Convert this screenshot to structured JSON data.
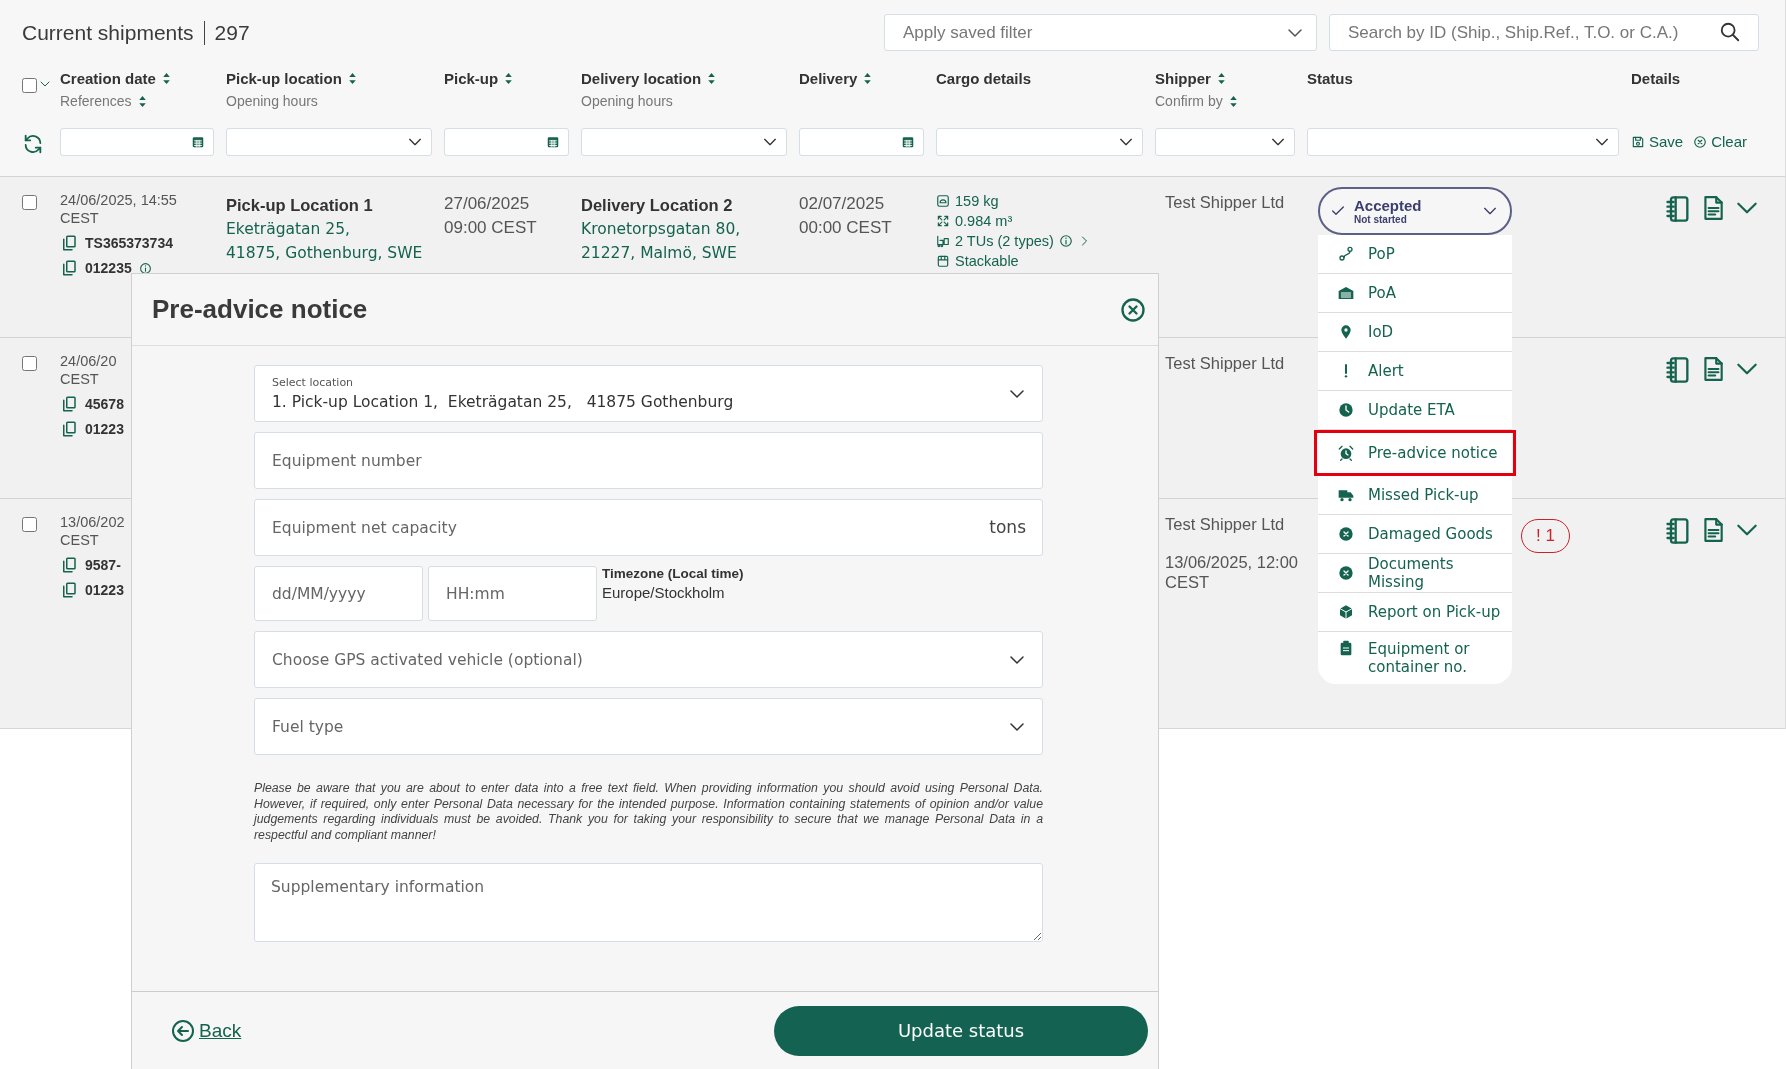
{
  "header": {
    "title": "Current shipments",
    "count": "297",
    "saved_filter": {
      "placeholder": "Apply saved filter"
    },
    "search": {
      "placeholder": "Search by ID (Ship., Ship.Ref., T.O. or C.A.)"
    }
  },
  "table": {
    "select_all": {
      "checked": false
    },
    "columns": [
      {
        "label": "Creation date",
        "sortable": true,
        "sub_label": "References",
        "sub_sortable": true,
        "filter": {
          "kind": "date"
        }
      },
      {
        "label": "Pick-up location",
        "sortable": true,
        "sub_label": "Opening hours",
        "sub_sortable": false,
        "filter": {
          "kind": "select"
        }
      },
      {
        "label": "Pick-up",
        "sortable": true,
        "filter": {
          "kind": "date"
        }
      },
      {
        "label": "Delivery location",
        "sortable": true,
        "sub_label": "Opening hours",
        "sub_sortable": false,
        "filter": {
          "kind": "select"
        }
      },
      {
        "label": "Delivery",
        "sortable": true,
        "filter": {
          "kind": "date"
        }
      },
      {
        "label": "Cargo details",
        "sortable": false,
        "filter": {
          "kind": "select"
        }
      },
      {
        "label": "Shipper",
        "sortable": true,
        "sub_label": "Confirm by",
        "sub_sortable": true,
        "filter": {
          "kind": "select"
        }
      },
      {
        "label": "Status",
        "sortable": false,
        "filter": {
          "kind": "select"
        }
      },
      {
        "label": "Details",
        "sortable": false,
        "filter": {
          "kind": "actions"
        }
      }
    ],
    "filter_actions": [
      {
        "kind": "save",
        "label": "Save"
      },
      {
        "kind": "clear",
        "label": "Clear"
      }
    ],
    "rows": [
      {
        "checked": false,
        "created": "24/06/2025, 14:55",
        "created_tz": "CEST",
        "references": [
          {
            "text": "TS365373734",
            "info": false
          },
          {
            "text": "012235",
            "info": true
          }
        ],
        "pickup_location": {
          "name": "Pick-up Location 1",
          "address": [
            "Eketrägatan 25,",
            "41875, Gothenburg, SWE"
          ]
        },
        "pickup": [
          "27/06/2025",
          "09:00 CEST"
        ],
        "delivery_location": {
          "name": "Delivery Location 2",
          "address": [
            "Kronetorpsgatan 80,",
            "21227, Malmö, SWE"
          ]
        },
        "delivery": [
          "02/07/2025",
          "00:00 CEST"
        ],
        "cargo": [
          {
            "kind": "weight",
            "text": "159 kg"
          },
          {
            "kind": "volume",
            "text": "0.984 m³"
          },
          {
            "kind": "units",
            "text": "2 TUs (2 types)",
            "info": true,
            "expandable": true
          },
          {
            "kind": "stackable",
            "text": "Stackable"
          }
        ],
        "shipper": "Test Shipper Ltd"
      },
      {
        "checked": false,
        "created": "24/06/20",
        "created_tz": "CEST",
        "references": [
          {
            "text": "45678"
          },
          {
            "text": "01223"
          }
        ],
        "shipper": "Test Shipper Ltd"
      },
      {
        "checked": false,
        "created": "13/06/202",
        "created_tz": "CEST",
        "references": [
          {
            "text": "9587-"
          },
          {
            "text": "01223"
          }
        ],
        "shipper": "Test Shipper Ltd",
        "confirm_by": "13/06/2025, 12:00 CEST",
        "alerts": "! 1"
      }
    ]
  },
  "status_menu": {
    "status": "Accepted",
    "substatus": "Not started",
    "items": [
      {
        "kind": "pop",
        "label": "PoP",
        "highlighted": false
      },
      {
        "kind": "poa",
        "label": "PoA",
        "highlighted": false
      },
      {
        "kind": "iod",
        "label": "IoD",
        "highlighted": false
      },
      {
        "kind": "alert",
        "label": "Alert",
        "highlighted": false
      },
      {
        "kind": "eta",
        "label": "Update ETA",
        "highlighted": false
      },
      {
        "kind": "pre_advice",
        "label": "Pre-advice notice",
        "highlighted": true
      },
      {
        "kind": "missed_pickup",
        "label": "Missed Pick-up",
        "highlighted": false
      },
      {
        "kind": "damaged",
        "label": "Damaged Goods",
        "highlighted": false
      },
      {
        "kind": "documents",
        "label": "Documents Missing",
        "highlighted": false
      },
      {
        "kind": "report",
        "label": "Report on Pick-up",
        "highlighted": false
      },
      {
        "kind": "equipment",
        "label": "Equipment or container no.",
        "highlighted": false
      }
    ]
  },
  "modal": {
    "title": "Pre-advice notice",
    "fields": [
      {
        "kind": "select",
        "label": "Select location",
        "value": "1. Pick-up Location 1,  Eketrägatan 25,   41875 Gothenburg"
      },
      {
        "kind": "text",
        "placeholder": "Equipment number"
      },
      {
        "kind": "unit",
        "placeholder": "Equipment net capacity",
        "unit": "tons"
      },
      {
        "kind": "datetime",
        "date_placeholder": "dd/MM/yyyy",
        "time_placeholder": "HH:mm",
        "timezone_label": "Timezone (Local time)",
        "timezone": "Europe/Stockholm"
      },
      {
        "kind": "select",
        "placeholder": "Choose GPS activated vehicle (optional)"
      },
      {
        "kind": "select",
        "placeholder": "Fuel type"
      }
    ],
    "notice": "Please be aware that you are about to enter data into a free text field. When providing information you should avoid using Personal Data. However, if required, only enter Personal Data necessary for the intended purpose. Information containing statements of opinion and/or value judgements regarding individuals must be avoided. Thank you for taking your responsibility to secure that we manage Personal Data in a respectful and compliant manner!",
    "supplementary": {
      "placeholder": "Supplementary information"
    },
    "back": "Back",
    "submit": "Update status"
  }
}
